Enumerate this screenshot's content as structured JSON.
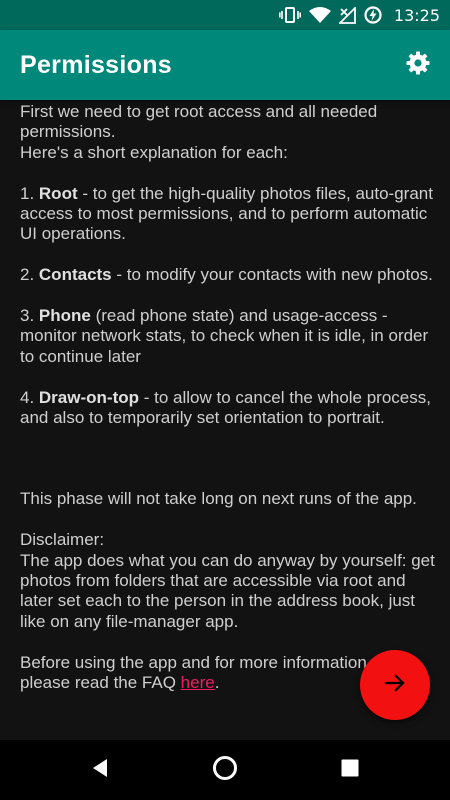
{
  "status_bar": {
    "time": "13:25",
    "icons": [
      "vibrate-icon",
      "wifi-icon",
      "cellular-no-signal-icon",
      "battery-charging-icon"
    ]
  },
  "app_bar": {
    "title": "Permissions",
    "settings_icon": "gear-icon"
  },
  "content": {
    "intro_line1": "First we need to get root access and all needed permissions.",
    "intro_line2": "Here's a short explanation for each:",
    "items": [
      {
        "prefix": "1. ",
        "term": "Root",
        "text": " - to get the high-quality photos files, auto-grant access to most permissions, and to perform automatic UI operations."
      },
      {
        "prefix": "2. ",
        "term": "Contacts",
        "text": " - to modify your contacts with new photos."
      },
      {
        "prefix": "3. ",
        "term": "Phone",
        "text": " (read phone state) and usage-access - monitor network stats, to check when it is idle, in order to continue later"
      },
      {
        "prefix": "4. ",
        "term": "Draw-on-top",
        "text": " - to allow to cancel the whole process, and also to temporarily set orientation to portrait."
      }
    ],
    "phase_note": "This phase will not take long on next runs of the app.",
    "disclaimer_title": "Disclaimer:",
    "disclaimer_text": "The app does what you can do anyway by yourself: get photos from folders that are accessible via root and later set each to the person in the address book, just like on any file-manager app.",
    "faq_line1": "Before using the app and for more information,",
    "faq_prefix": "please read the FAQ ",
    "faq_link": "here",
    "faq_suffix": "."
  },
  "fab": {
    "icon": "arrow-right-icon"
  },
  "nav_bar": {
    "icons": [
      "back-icon",
      "home-icon",
      "recents-icon"
    ]
  },
  "colors": {
    "status_bar": "#00695c",
    "app_bar": "#00897b",
    "background": "#121212",
    "fab": "#f21010",
    "link": "#e91e63"
  }
}
